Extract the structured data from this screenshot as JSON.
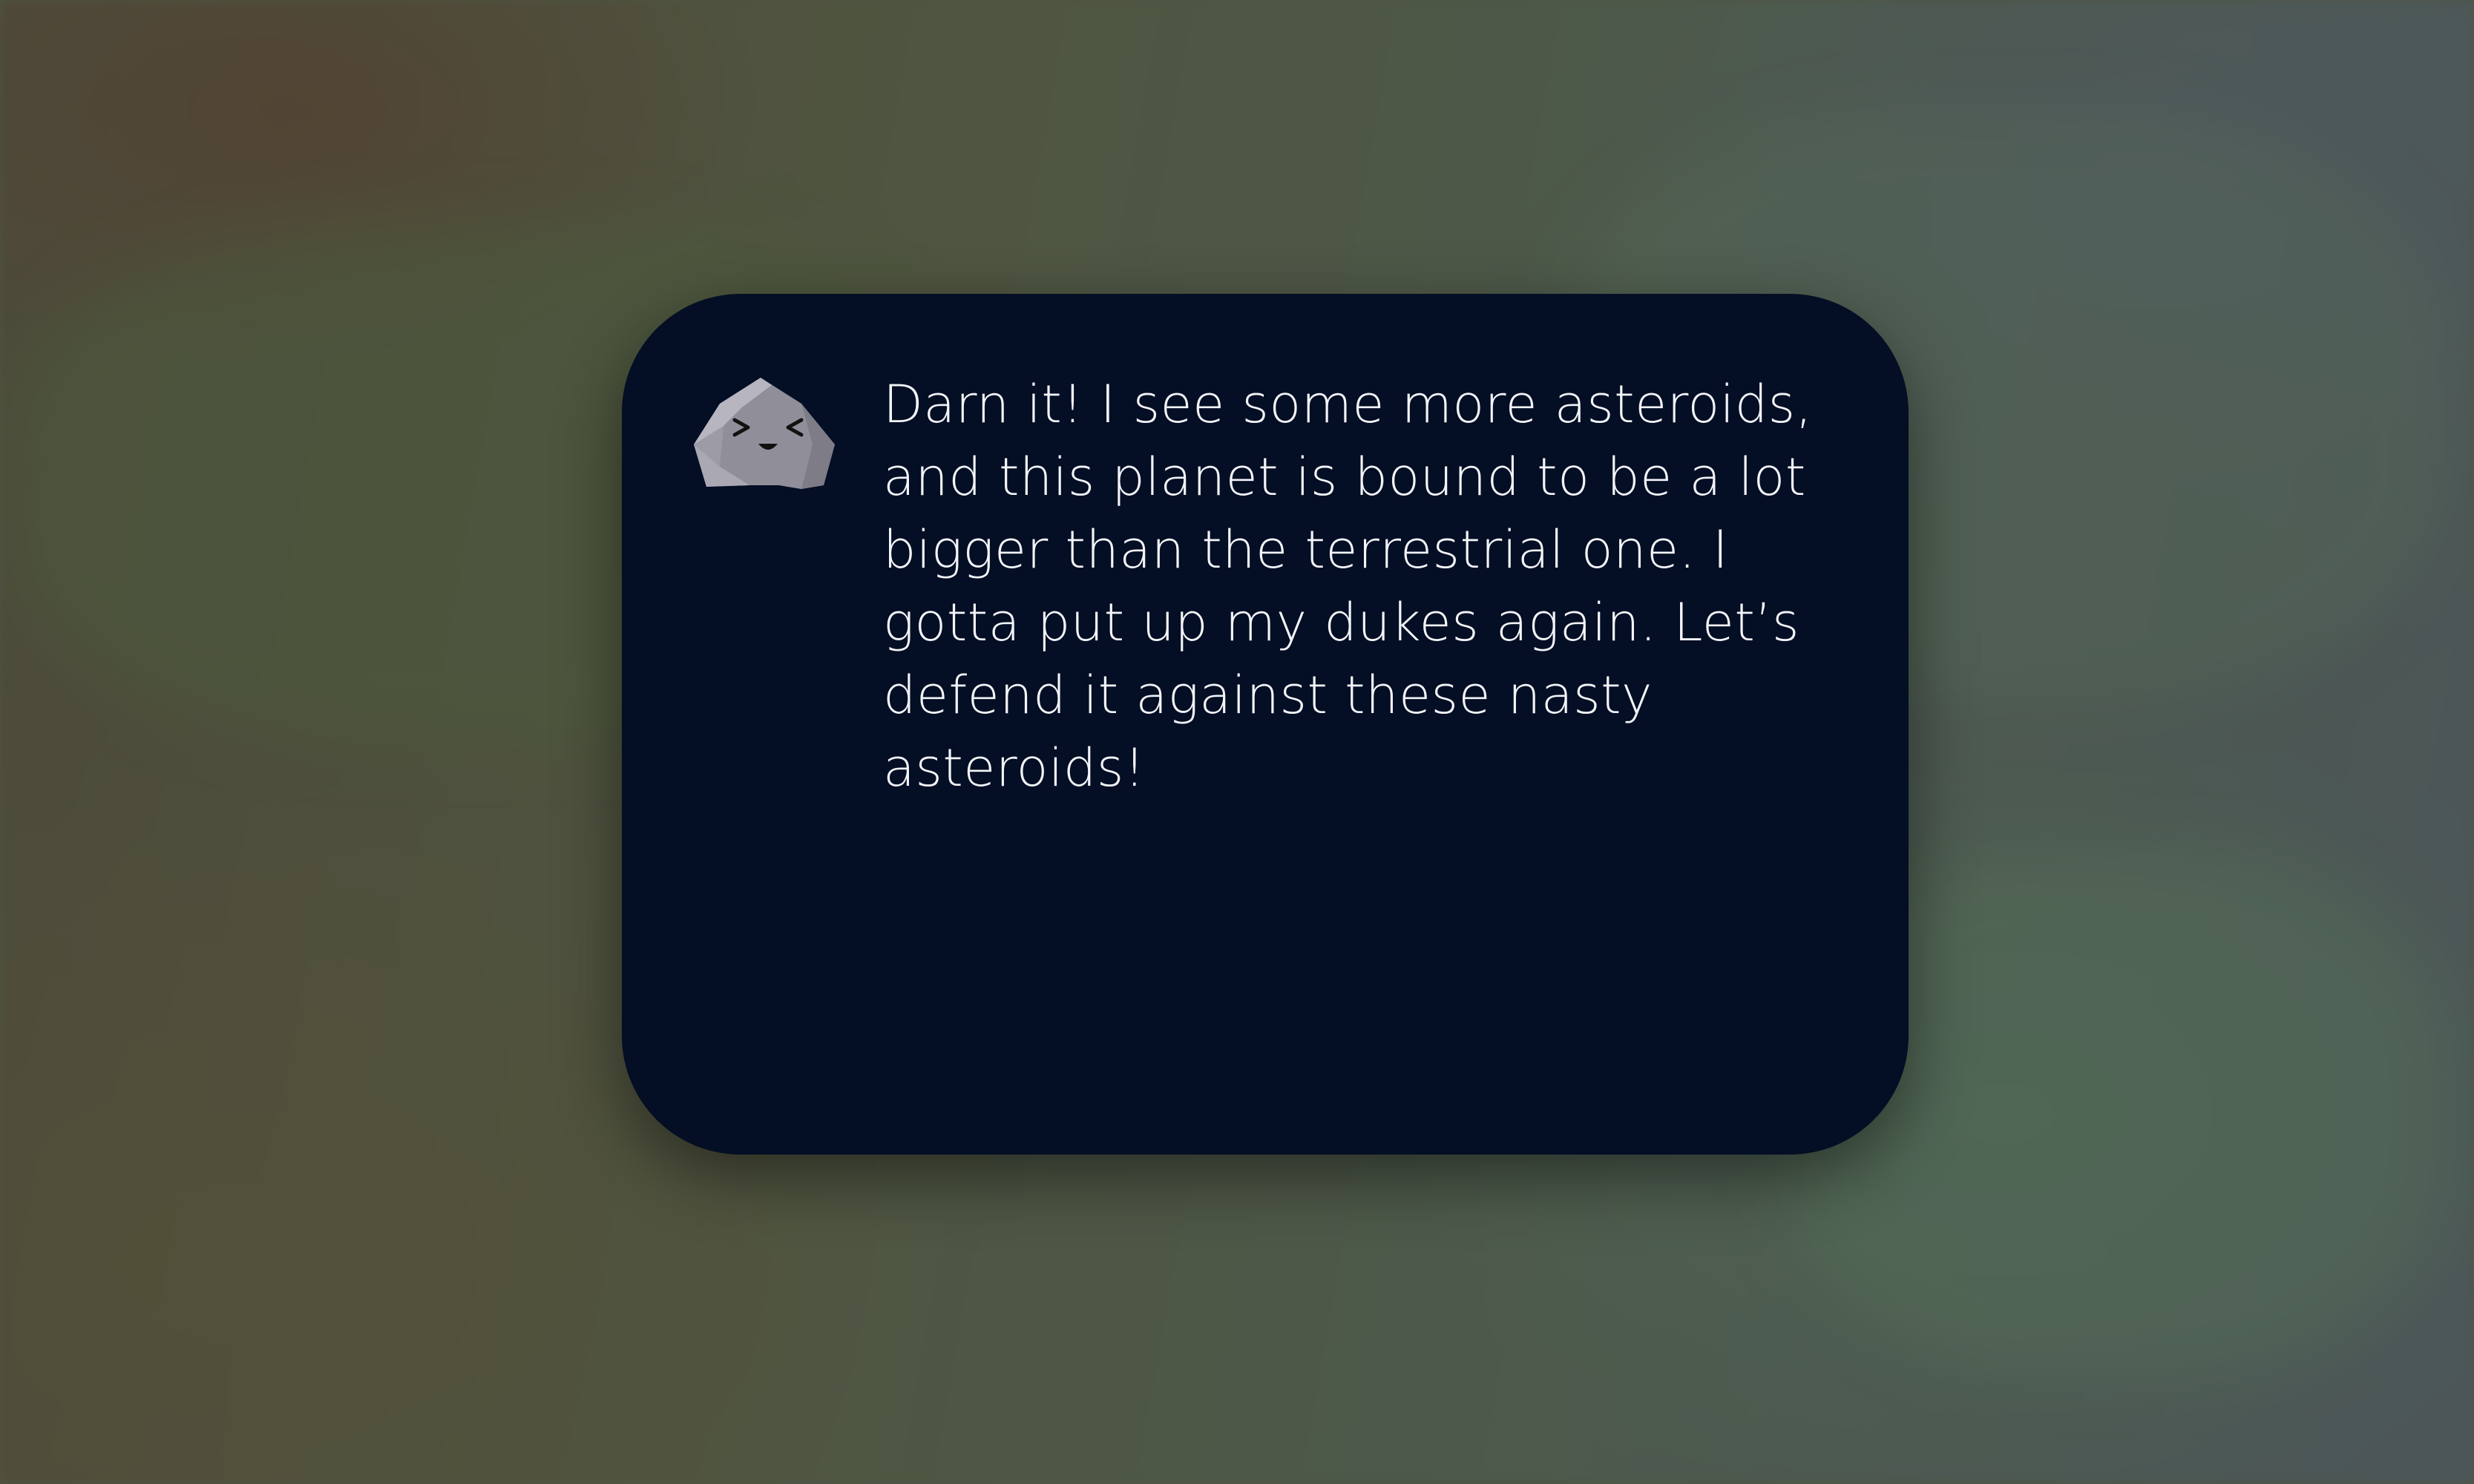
{
  "dialog": {
    "speaker_icon": "asteroid-character-icon",
    "message": "Darn it! I see some more asteroids, and this planet is bound to be a lot bigger than the terrestrial one. I gotta put up my dukes again. Let’s defend it against these nasty asteroids!"
  },
  "colors": {
    "dialog_background": "#040e24",
    "text": "#f2f4f8"
  }
}
